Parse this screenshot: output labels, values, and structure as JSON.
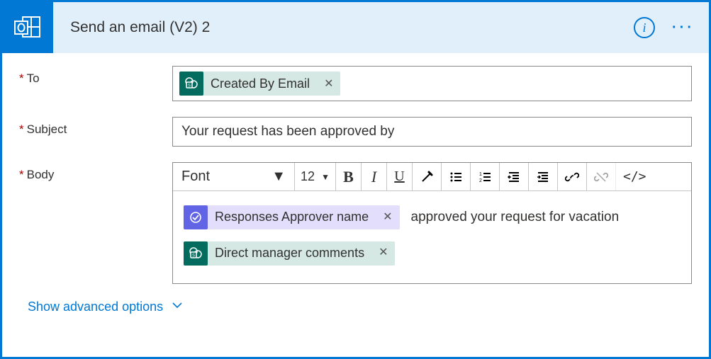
{
  "header": {
    "title": "Send an email (V2) 2"
  },
  "fields": {
    "to": {
      "label": "To"
    },
    "subject": {
      "label": "Subject",
      "value": "Your request has been approved by"
    },
    "body": {
      "label": "Body"
    }
  },
  "tokens": {
    "createdByEmail": "Created By Email",
    "approverName": "Responses Approver name",
    "managerComments": "Direct manager comments"
  },
  "bodyText": {
    "afterApprover": "approved your request for vacation"
  },
  "toolbar": {
    "font": "Font",
    "size": "12"
  },
  "advanced": "Show advanced options"
}
